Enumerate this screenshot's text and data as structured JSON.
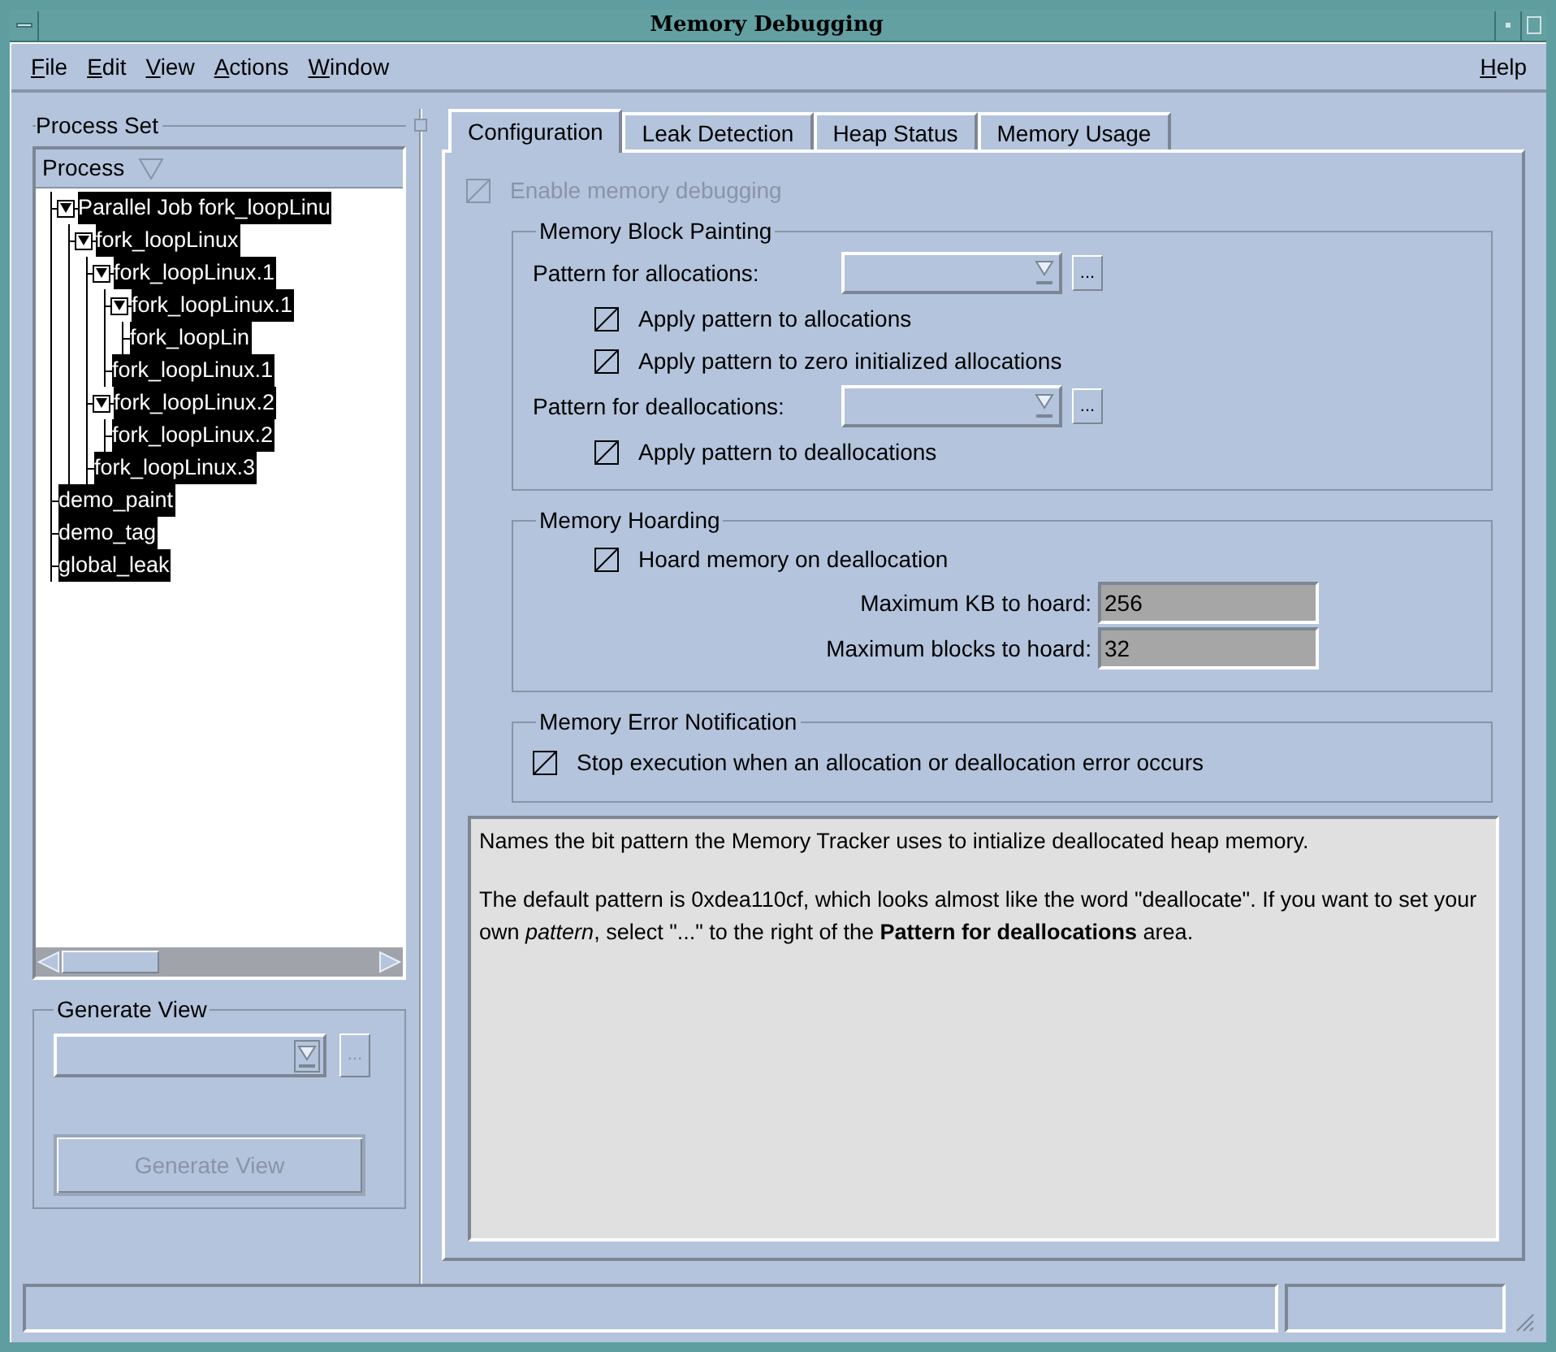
{
  "window": {
    "title": "Memory Debugging"
  },
  "menu": [
    {
      "label": "File"
    },
    {
      "label": "Edit"
    },
    {
      "label": "View"
    },
    {
      "label": "Actions"
    },
    {
      "label": "Window"
    }
  ],
  "help_menu": {
    "label": "Help"
  },
  "process_set": {
    "title": "Process Set",
    "column_header": "Process",
    "tree": [
      {
        "label": "Parallel Job fork_loopLinu",
        "selected": true,
        "expanded": true,
        "children": [
          {
            "label": "fork_loopLinux",
            "selected": true,
            "expanded": true,
            "children": [
              {
                "label": "fork_loopLinux.1",
                "selected": true,
                "expanded": true,
                "children": [
                  {
                    "label": "fork_loopLinux.1",
                    "selected": true,
                    "expanded": true,
                    "children": [
                      {
                        "label": "fork_loopLin",
                        "selected": true
                      }
                    ]
                  },
                  {
                    "label": "fork_loopLinux.1",
                    "selected": true
                  }
                ]
              },
              {
                "label": "fork_loopLinux.2",
                "selected": true,
                "expanded": true,
                "children": [
                  {
                    "label": "fork_loopLinux.2",
                    "selected": true
                  }
                ]
              },
              {
                "label": "fork_loopLinux.3",
                "selected": true
              }
            ]
          }
        ]
      },
      {
        "label": "demo_paint",
        "selected": true
      },
      {
        "label": "demo_tag",
        "selected": true
      },
      {
        "label": "global_leak",
        "selected": true
      }
    ]
  },
  "generate_view": {
    "title": "Generate View",
    "browse_button": "...",
    "button": {
      "label": "Generate View",
      "disabled": true
    }
  },
  "tabs": [
    {
      "label": "Configuration",
      "selected": true
    },
    {
      "label": "Leak Detection",
      "selected": false
    },
    {
      "label": "Heap Status",
      "selected": false
    },
    {
      "label": "Memory Usage",
      "selected": false
    }
  ],
  "configuration": {
    "enable": {
      "label": "Enable memory debugging",
      "checked": true,
      "disabled": true
    },
    "block_painting": {
      "title": "Memory Block Painting",
      "alloc_pattern": {
        "label": "Pattern for allocations:",
        "browse_button": "..."
      },
      "alloc_options": [
        {
          "label": "Apply pattern to allocations",
          "checked": true
        },
        {
          "label": "Apply pattern to zero initialized allocations",
          "checked": true
        }
      ],
      "dealloc_pattern": {
        "label": "Pattern for deallocations:",
        "browse_button": "..."
      },
      "dealloc_options": [
        {
          "label": "Apply pattern to deallocations",
          "checked": true
        }
      ]
    },
    "hoarding": {
      "title": "Memory Hoarding",
      "option": {
        "label": "Hoard memory on deallocation",
        "checked": true
      },
      "fields": [
        {
          "label": "Maximum KB to hoard:",
          "value": "256"
        },
        {
          "label": "Maximum blocks to hoard:",
          "value": "32"
        }
      ]
    },
    "error_notification": {
      "title": "Memory Error Notification",
      "option": {
        "label": "Stop execution when an allocation or deallocation error occurs",
        "checked": true
      }
    }
  },
  "help": {
    "paragraphs": [
      "Names the bit pattern the Memory Tracker uses to intialize deallocated heap memory.",
      "The default pattern is 0xdea110cf, which looks almost like the word \"deallocate\". If you want to set your own *pattern*, select \"...\" to the right of the **Pattern for deallocations** area."
    ]
  }
}
